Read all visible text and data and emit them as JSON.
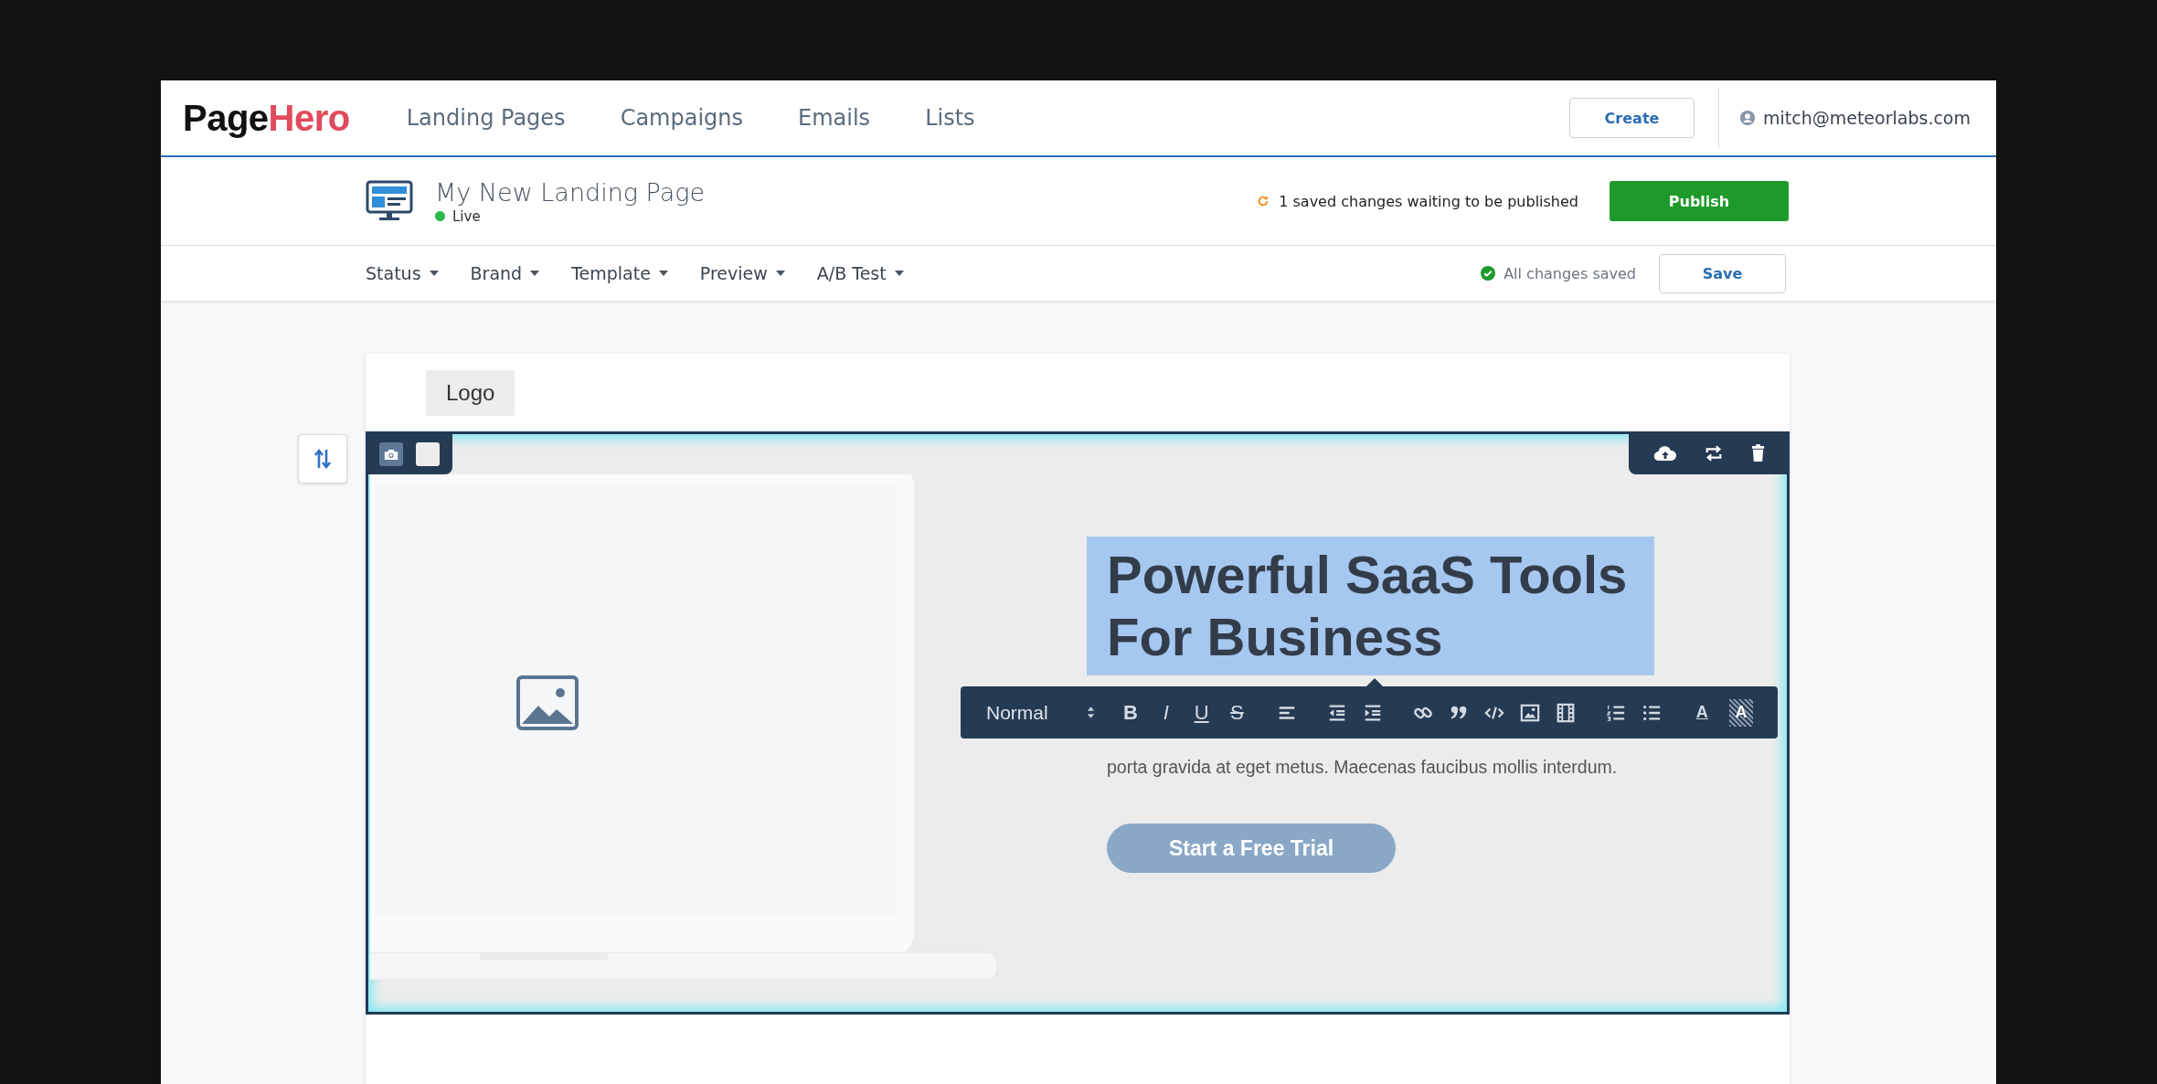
{
  "top_nav": {
    "logo": {
      "first": "Page",
      "second": "Hero"
    },
    "links": [
      {
        "label": "Landing Pages"
      },
      {
        "label": "Campaigns"
      },
      {
        "label": "Emails"
      },
      {
        "label": "Lists"
      }
    ],
    "create_button": "Create",
    "user": "mitch@meteorlabs.com"
  },
  "page_bar": {
    "title": "My New Landing Page",
    "status": "Live",
    "live": true,
    "notice": "1 saved changes waiting to be published",
    "publish_button": "Publish"
  },
  "menu_bar": {
    "menus": [
      "Status",
      "Brand",
      "Template",
      "Preview",
      "A/B Test"
    ],
    "save_state": "All changes saved",
    "save_button": "Save"
  },
  "editor": {
    "logo_placeholder": "Logo",
    "hero": {
      "headline": "Powerful SaaS Tools For Business",
      "headline_selected": true,
      "paragraph_lines": [
        "porta gravida at eget metus. Maecenas faucibus mollis interdum."
      ],
      "cta": "Start a Free Trial"
    },
    "format_toolbar": {
      "block_style": "Normal",
      "tools": [
        {
          "kind": "bold",
          "glyph": "B"
        },
        {
          "kind": "italic",
          "glyph": "I"
        },
        {
          "kind": "underline",
          "glyph": "U"
        },
        {
          "kind": "strike",
          "glyph": "S"
        },
        {
          "kind": "align"
        },
        {
          "kind": "outdent"
        },
        {
          "kind": "indent"
        },
        {
          "kind": "link"
        },
        {
          "kind": "quote"
        },
        {
          "kind": "code"
        },
        {
          "kind": "image"
        },
        {
          "kind": "video"
        },
        {
          "kind": "ordered-list"
        },
        {
          "kind": "bullet-list"
        },
        {
          "kind": "text-color",
          "glyph": "A"
        },
        {
          "kind": "highlight",
          "glyph": "A"
        }
      ]
    }
  }
}
